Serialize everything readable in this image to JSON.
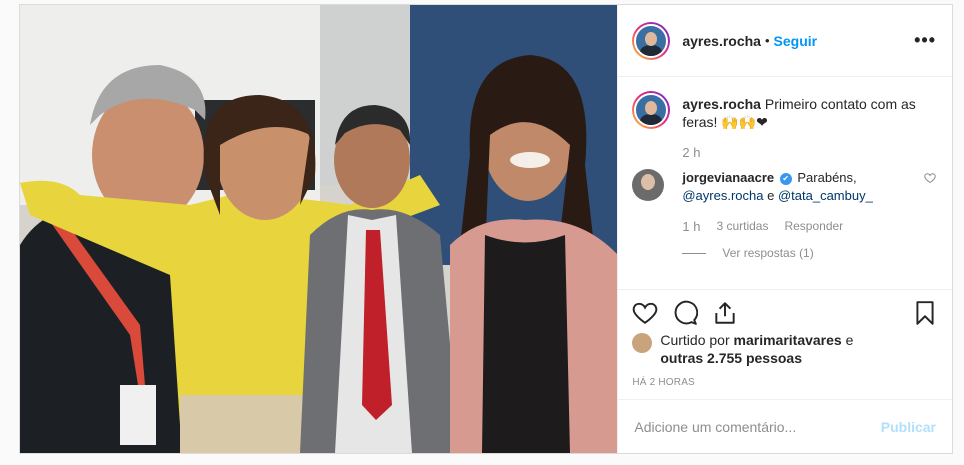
{
  "post": {
    "header": {
      "username": "ayres.rocha",
      "separator": "•",
      "follow_label": "Seguir",
      "more_label": "•••"
    },
    "caption": {
      "username": "ayres.rocha",
      "text": "Primeiro contato com as feras! 🙌🙌❤",
      "time": "2 h"
    },
    "comment": {
      "username": "jorgevianaacre",
      "verified_mark": "✔",
      "text_before": "Parabéns,",
      "mention_1": "@ayres.rocha",
      "connector": "e",
      "mention_2": "@tata_cambuy_",
      "time": "1 h",
      "likes": "3 curtidas",
      "reply_label": "Responder",
      "view_replies": "Ver respostas (1)"
    },
    "likes": {
      "prefix": "Curtido por",
      "user": "marimaritavares",
      "connector": "e",
      "others": "outras 2.755 pessoas"
    },
    "time_ago": "HÁ 2 HORAS",
    "comment_input": {
      "placeholder": "Adicione um comentário...",
      "value": ""
    },
    "publish_label": "Publicar"
  },
  "icons": [
    "heart-icon",
    "comment-icon",
    "share-icon",
    "bookmark-icon",
    "like-heart-small-icon",
    "more-options-icon"
  ],
  "colors": {
    "link_blue": "#0095f6",
    "publish_disabled": "#b2dffc",
    "muted": "#8e8e8e",
    "text": "#262626"
  }
}
